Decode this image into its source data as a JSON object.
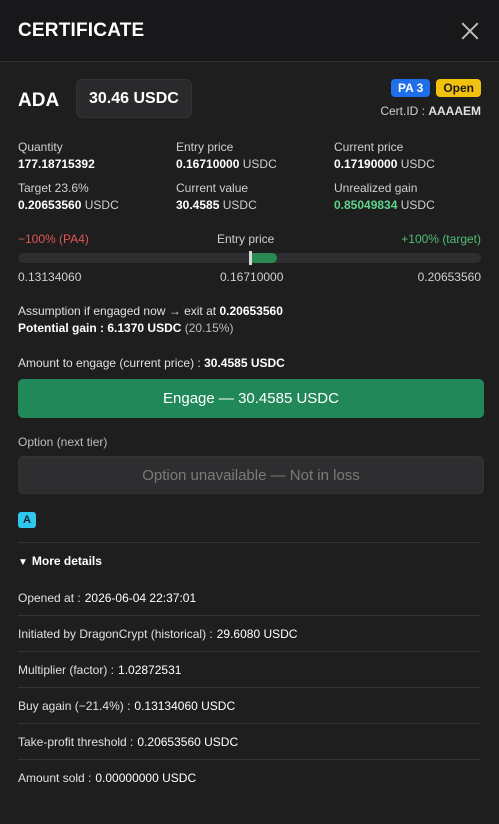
{
  "header": {
    "title": "CERTIFICATE"
  },
  "asset": {
    "name": "ADA",
    "amount": "30.46 USDC"
  },
  "badges": {
    "pa": "PA 3",
    "status": "Open"
  },
  "cert": {
    "label": "Cert.ID :",
    "id": "AAAAEM"
  },
  "stats": [
    {
      "label": "Quantity",
      "value": "177.18715392",
      "unit": ""
    },
    {
      "label": "Entry price",
      "value": "0.16710000",
      "unit": "USDC"
    },
    {
      "label": "Current price",
      "value": "0.17190000",
      "unit": "USDC"
    },
    {
      "label": "Target 23.6%",
      "value": "0.20653560",
      "unit": "USDC"
    },
    {
      "label": "Current value",
      "value": "30.4585",
      "unit": "USDC"
    },
    {
      "label": "Unrealized gain",
      "value": "0.85049834",
      "unit": "USDC"
    }
  ],
  "range": {
    "left_label": "−100% (PA4)",
    "mid_label": "Entry price",
    "right_label": "+100% (target)",
    "left_value": "0.13134060",
    "mid_value": "0.16710000",
    "right_value": "0.20653560",
    "marker_fraction": 0.5,
    "fill_fraction": 0.56
  },
  "assumption": {
    "prefix": "Assumption if engaged now → exit at",
    "exit": "0.20653560",
    "gain_label": "Potential gain :",
    "gain_value": "6.1370 USDC",
    "gain_pct": "(20.15%)"
  },
  "engage": {
    "amount_label": "Amount to engage (current price) :",
    "amount_value": "30.4585 USDC",
    "button": "Engage — 30.4585 USDC"
  },
  "option": {
    "label": "Option (next tier)",
    "button": "Option unavailable — Not in loss"
  },
  "tag": "A",
  "more": {
    "label": "More details"
  },
  "details": [
    {
      "label": "Opened at :",
      "value": "2026-06-04 22:37:01"
    },
    {
      "label": "Initiated by DragonCrypt (historical) :",
      "value": "29.6080 USDC"
    },
    {
      "label": "Multiplier (factor) :",
      "value": "1.02872531"
    },
    {
      "label": "Buy again (−21.4%) :",
      "value": "0.13134060 USDC"
    },
    {
      "label": "Take-profit threshold :",
      "value": "0.20653560 USDC"
    },
    {
      "label": "Amount sold :",
      "value": "0.00000000 USDC"
    }
  ]
}
